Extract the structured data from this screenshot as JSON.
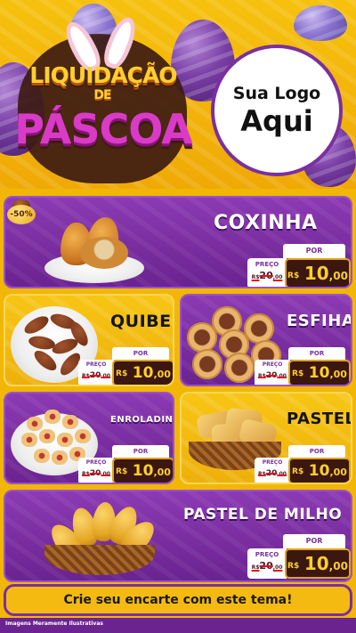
{
  "header": {
    "title_line1": "LIQUIDAÇÃO",
    "title_line2": "DE",
    "title_line3": "PÁSCOA",
    "logo_line1": "Sua Logo",
    "logo_line2": "Aqui"
  },
  "badge": "-50%",
  "price_common": {
    "por_label": "POR",
    "preco_label": "PREÇO",
    "currency": "R$"
  },
  "products": [
    {
      "name": "COXINHA",
      "old_price": "20,00",
      "old_price_int": "20",
      "old_price_cents": ",00",
      "new_price_int": "10",
      "new_price_cents": ",00"
    },
    {
      "name": "QUIBE",
      "old_price_int": "20",
      "old_price_cents": ",00",
      "new_price_int": "10",
      "new_price_cents": ",00"
    },
    {
      "name": "ESFIHA",
      "old_price_int": "20",
      "old_price_cents": ",00",
      "new_price_int": "10",
      "new_price_cents": ",00"
    },
    {
      "name": "ENROLADINHO",
      "old_price_int": "20",
      "old_price_cents": ",00",
      "new_price_int": "10",
      "new_price_cents": ",00"
    },
    {
      "name": "PASTEL",
      "old_price_int": "20",
      "old_price_cents": ",00",
      "new_price_int": "10",
      "new_price_cents": ",00"
    },
    {
      "name": "PASTEL DE MILHO",
      "old_price_int": "20",
      "old_price_cents": ",00",
      "new_price_int": "10",
      "new_price_cents": ",00"
    }
  ],
  "cta": "Crie seu encarte com este tema!",
  "footer_note": "Imagens Meramente Ilustrativas",
  "colors": {
    "brand_purple": "#7b2fa0",
    "brand_yellow": "#f4ba12",
    "price_dark": "#3b1710",
    "price_gold": "#ffcf2e"
  }
}
